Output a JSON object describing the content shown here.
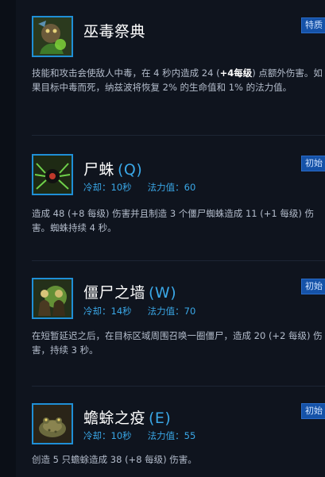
{
  "abilities": [
    {
      "name": "巫毒祭典",
      "key": "",
      "badge": "特质",
      "cooldown_label": "",
      "cooldown_value": "",
      "mana_label": "",
      "mana_value": "",
      "desc_parts": [
        {
          "text": "技能和攻击会使敌人中毒，在 4 秒内造成 24 (",
          "strong": false
        },
        {
          "text": "+4每级",
          "strong": true
        },
        {
          "text": ") 点额外伤害。如果目标中毒而死，纳兹波将恢复 2% 的生命值和 1% 的法力值。",
          "strong": false
        }
      ],
      "icon": "voodoo-ritual-icon"
    },
    {
      "name": "尸蛛",
      "key": "(Q)",
      "badge": "初始",
      "cooldown_label": "冷却：",
      "cooldown_value": "10秒",
      "mana_label": "法力值：",
      "mana_value": "60",
      "desc_parts": [
        {
          "text": "造成 48 (+8 每级) 伤害并且制造 3 个僵尸蜘蛛造成 11 (+1 每级) 伤害。蜘蛛持续 4 秒。",
          "strong": false
        }
      ],
      "icon": "corpse-spiders-icon"
    },
    {
      "name": "僵尸之墙",
      "key": "(W)",
      "badge": "初始",
      "cooldown_label": "冷却：",
      "cooldown_value": "14秒",
      "mana_label": "法力值：",
      "mana_value": "70",
      "desc_parts": [
        {
          "text": "在短暂延迟之后，在目标区域周围召唤一圈僵尸，造成 20 (+2 每级) 伤害，持续 3 秒。",
          "strong": false
        }
      ],
      "icon": "zombie-wall-icon"
    },
    {
      "name": "蟾蜍之疫",
      "key": "(E)",
      "badge": "初始",
      "cooldown_label": "冷却：",
      "cooldown_value": "10秒",
      "mana_label": "法力值：",
      "mana_value": "55",
      "desc_parts": [
        {
          "text": "创造 5 只蟾蜍造成 38 (+8 每级) 伤害。",
          "strong": false
        }
      ],
      "icon": "plague-of-toads-icon"
    }
  ],
  "colors": {
    "accent": "#3aa8e8",
    "badge_bg": "#1552a8",
    "icon_border": "#1f8fd6",
    "background": "#0f141e"
  }
}
